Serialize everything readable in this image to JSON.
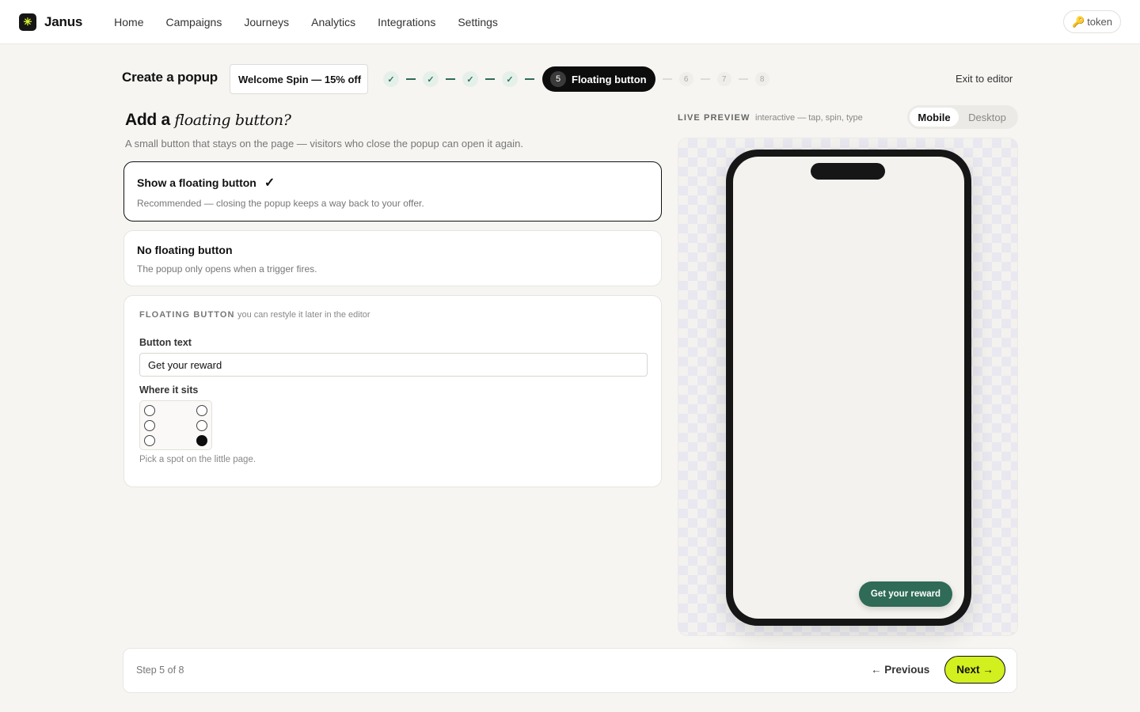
{
  "app": {
    "brand_glyph": "✳",
    "brand_name": "Janus",
    "nav": [
      "Home",
      "Campaigns",
      "Journeys",
      "Analytics",
      "Integrations",
      "Settings"
    ],
    "token_icon": "🔑",
    "token_label": "token"
  },
  "header": {
    "title": "Create a popup",
    "campaign_name": "Welcome Spin — 15% off",
    "exit_label": "Exit to editor"
  },
  "stepper": {
    "done_steps": [
      "✓",
      "✓",
      "✓",
      "✓"
    ],
    "active": {
      "number": "5",
      "label": "Floating button"
    },
    "future_steps": [
      "6",
      "7",
      "8"
    ]
  },
  "section": {
    "heading_plain": "Add a",
    "heading_italic": "floating button?",
    "subtitle": "A small button that stays on the page — visitors who close the popup can open it again."
  },
  "options": [
    {
      "title": "Show a floating button",
      "check": "✓",
      "desc": "Recommended — closing the popup keeps a way back to your offer.",
      "selected": true
    },
    {
      "title": "No floating button",
      "desc": "The popup only opens when a trigger fires.",
      "selected": false
    }
  ],
  "config": {
    "eyebrow": "FLOATING BUTTON",
    "note": "you can restyle it later in the editor",
    "button_text_label": "Button text",
    "button_text_value": "Get your reward",
    "position_label": "Where it sits",
    "selected_position": "bottom-right",
    "hint": "Pick a spot on the little page."
  },
  "preview": {
    "label": "LIVE PREVIEW",
    "note": "interactive — tap, spin, type",
    "toggle": [
      "Mobile",
      "Desktop"
    ],
    "active_device": "Mobile",
    "floating_button_label": "Get your reward",
    "floating_button_color": "#2f6b57"
  },
  "footer": {
    "step_count": "Step 5 of 8",
    "previous_label": "← Previous",
    "next_label": "Next →"
  },
  "colors": {
    "accent": "#d2ef1e",
    "brand_green": "#2f6b57"
  }
}
